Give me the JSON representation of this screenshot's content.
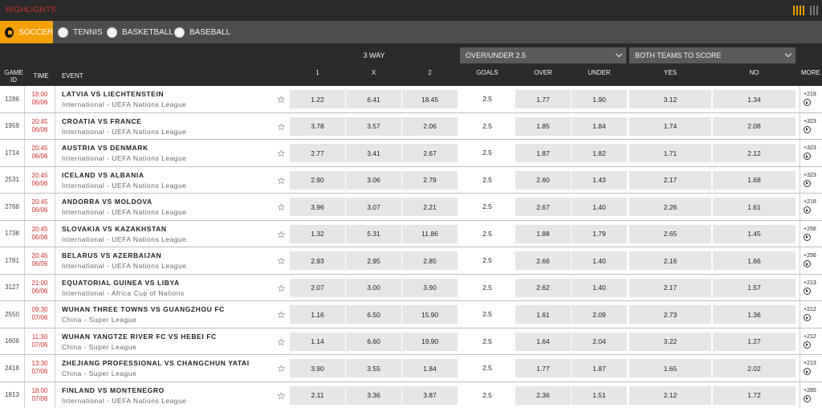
{
  "topbar": {
    "title": "HIGHLIGHTS"
  },
  "sports": [
    {
      "label": "SOCCER",
      "icon": "soccer-icon"
    },
    {
      "label": "TENNIS",
      "icon": "tennis-icon"
    },
    {
      "label": "BASKETBALL",
      "icon": "basketball-icon"
    },
    {
      "label": "BASEBALL",
      "icon": "baseball-icon"
    }
  ],
  "header": {
    "three_way": "3 WAY",
    "over_under_select": "OVER/UNDER 2.5",
    "btts_select": "BOTH TEAMS TO SCORE",
    "game_id": "GAME ID",
    "time": "TIME",
    "event": "EVENT",
    "col_1": "1",
    "col_x": "X",
    "col_2": "2",
    "goals": "GOALS",
    "over": "OVER",
    "under": "UNDER",
    "yes": "YES",
    "no": "NO",
    "more": "MORE"
  },
  "colors": {
    "accent": "#f5a100",
    "time_red": "#d4302f",
    "header_bg": "#2b2b2b"
  },
  "matches": [
    {
      "id": "1286",
      "time": "18:00",
      "date": "06/06",
      "teams": "LATVIA VS LIECHTENSTEIN",
      "league": "International - UEFA Nations League",
      "o1": "1.22",
      "ox": "6.41",
      "o2": "18.45",
      "goals": "2.5",
      "over": "1.77",
      "under": "1.90",
      "yes": "3.12",
      "no": "1.34",
      "more": "+219"
    },
    {
      "id": "1959",
      "time": "20:45",
      "date": "06/06",
      "teams": "CROATIA VS FRANCE",
      "league": "International - UEFA Nations League",
      "o1": "3.78",
      "ox": "3.57",
      "o2": "2.06",
      "goals": "2.5",
      "over": "1.85",
      "under": "1.84",
      "yes": "1.74",
      "no": "2.08",
      "more": "+323"
    },
    {
      "id": "1714",
      "time": "20:45",
      "date": "06/06",
      "teams": "AUSTRIA VS DENMARK",
      "league": "International - UEFA Nations League",
      "o1": "2.77",
      "ox": "3.41",
      "o2": "2.67",
      "goals": "2.5",
      "over": "1.87",
      "under": "1.82",
      "yes": "1.71",
      "no": "2.12",
      "more": "+323"
    },
    {
      "id": "2531",
      "time": "20:45",
      "date": "06/06",
      "teams": "ICELAND VS ALBANIA",
      "league": "International - UEFA Nations League",
      "o1": "2.90",
      "ox": "3.06",
      "o2": "2.79",
      "goals": "2.5",
      "over": "2.60",
      "under": "1.43",
      "yes": "2.17",
      "no": "1.68",
      "more": "+323"
    },
    {
      "id": "2768",
      "time": "20:45",
      "date": "06/06",
      "teams": "ANDORRA VS MOLDOVA",
      "league": "International - UEFA Nations League",
      "o1": "3.96",
      "ox": "3.07",
      "o2": "2.21",
      "goals": "2.5",
      "over": "2.67",
      "under": "1.40",
      "yes": "2.26",
      "no": "1.61",
      "more": "+218"
    },
    {
      "id": "1738",
      "time": "20:45",
      "date": "06/06",
      "teams": "SLOVAKIA VS KAZAKHSTAN",
      "league": "International - UEFA Nations League",
      "o1": "1.32",
      "ox": "5.31",
      "o2": "11.86",
      "goals": "2.5",
      "over": "1.88",
      "under": "1.79",
      "yes": "2.65",
      "no": "1.45",
      "more": "+256"
    },
    {
      "id": "1781",
      "time": "20:45",
      "date": "06/06",
      "teams": "BELARUS VS AZERBAIJAN",
      "league": "International - UEFA Nations League",
      "o1": "2.93",
      "ox": "2.95",
      "o2": "2.85",
      "goals": "2.5",
      "over": "2.66",
      "under": "1.40",
      "yes": "2.16",
      "no": "1.66",
      "more": "+256"
    },
    {
      "id": "3127",
      "time": "21:00",
      "date": "06/06",
      "teams": "EQUATORIAL GUINEA VS LIBYA",
      "league": "International - Africa Cup of Nations",
      "o1": "2.07",
      "ox": "3.00",
      "o2": "3.90",
      "goals": "2.5",
      "over": "2.62",
      "under": "1.40",
      "yes": "2.17",
      "no": "1.57",
      "more": "+213"
    },
    {
      "id": "2550",
      "time": "09:30",
      "date": "07/06",
      "teams": "WUHAN THREE TOWNS VS GUANGZHOU FC",
      "league": "China - Super League",
      "o1": "1.16",
      "ox": "6.50",
      "o2": "15.90",
      "goals": "2.5",
      "over": "1.61",
      "under": "2.09",
      "yes": "2.73",
      "no": "1.36",
      "more": "+212"
    },
    {
      "id": "1606",
      "time": "11:30",
      "date": "07/06",
      "teams": "WUHAN YANGTZE RIVER FC VS HEBEI FC",
      "league": "China - Super League",
      "o1": "1.14",
      "ox": "6.60",
      "o2": "19.90",
      "goals": "2.5",
      "over": "1.64",
      "under": "2.04",
      "yes": "3.22",
      "no": "1.27",
      "more": "+212"
    },
    {
      "id": "2418",
      "time": "13:30",
      "date": "07/06",
      "teams": "ZHEJIANG PROFESSIONAL VS CHANGCHUN YATAI",
      "league": "China - Super League",
      "o1": "3.90",
      "ox": "3.55",
      "o2": "1.84",
      "goals": "2.5",
      "over": "1.77",
      "under": "1.87",
      "yes": "1.65",
      "no": "2.02",
      "more": "+213"
    },
    {
      "id": "1813",
      "time": "18:00",
      "date": "07/06",
      "teams": "FINLAND VS MONTENEGRO",
      "league": "International - UEFA Nations League",
      "o1": "2.11",
      "ox": "3.36",
      "o2": "3.87",
      "goals": "2.5",
      "over": "2.36",
      "under": "1.51",
      "yes": "2.12",
      "no": "1.72",
      "more": "+285"
    }
  ]
}
